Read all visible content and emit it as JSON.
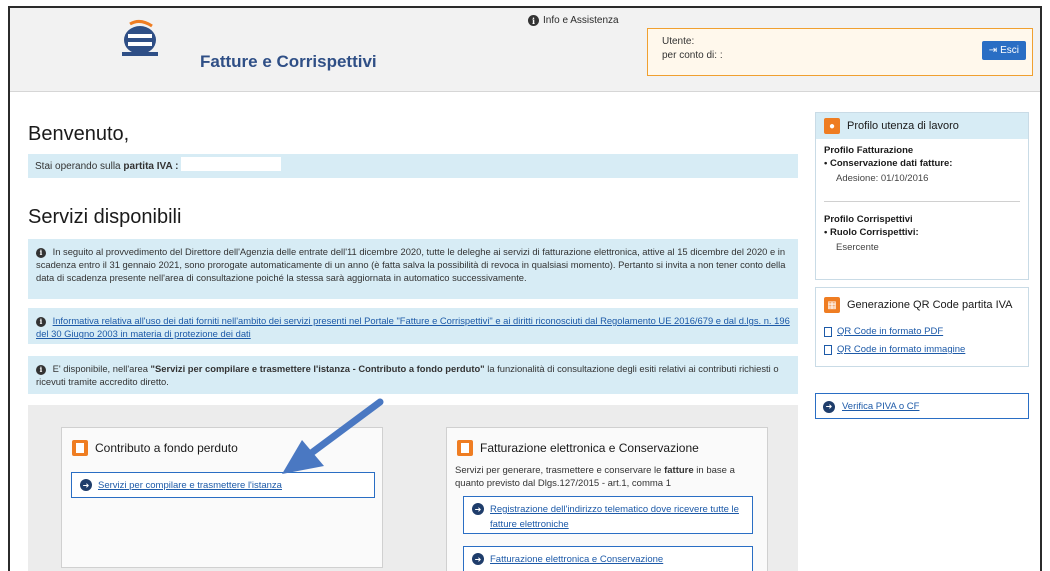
{
  "header": {
    "app_title": "Fatture e Corrispettivi",
    "info_link": "Info e Assistenza",
    "user_label": "Utente:",
    "on_behalf_label": "per conto di: :",
    "logout_label": "Esci"
  },
  "main": {
    "welcome": "Benvenuto,",
    "vat_prefix": "Stai operando sulla ",
    "vat_bold": "partita IVA :",
    "services_title": "Servizi disponibili",
    "notice_1": "In seguito al provvedimento del Direttore dell'Agenzia delle entrate dell'11 dicembre 2020, tutte le deleghe ai servizi di fatturazione elettronica, attive al 15 dicembre del 2020 e in scadenza entro il 31 gennaio 2021, sono prorogate automaticamente di un anno (è fatta salva la possibilità di revoca in qualsiasi momento). Pertanto si invita a non tener conto della data di scadenza presente nell'area di consultazione poiché la stessa sarà aggiornata in automatico successivamente.",
    "notice_2": "Informativa relativa all'uso dei dati forniti nell'ambito dei servizi presenti nel Portale \"Fatture e Corrispettivi\" e ai diritti riconosciuti dal Regolamento UE 2016/679 e dal d.lgs. n. 196 del 30 Giugno 2003 in materia di protezione dei dati",
    "notice_3_pre": "E' disponibile, nell'area ",
    "notice_3_bold": "\"Servizi per compilare e trasmettere l'istanza - Contributo a fondo perduto\"",
    "notice_3_post": " la funzionalità di consultazione degli esiti relativi ai contributi richiesti o ricevuti tramite accredito diretto."
  },
  "cards": {
    "contrib": {
      "title": "Contributo a fondo perduto",
      "link": "Servizi per compilare e trasmettere l'istanza"
    },
    "fatt": {
      "title": "Fatturazione elettronica e Conservazione",
      "desc_pre": "Servizi per generare, trasmettere e conservare le ",
      "desc_bold": "fatture",
      "desc_post": " in base a quanto previsto dal Dlgs.127/2015 - art.1, comma 1",
      "link_1": "Registrazione dell'indirizzo telematico dove ricevere tutte le fatture elettroniche",
      "link_2": "Fatturazione elettronica e Conservazione"
    }
  },
  "sidebar": {
    "profile_title": "Profilo utenza di lavoro",
    "fatt_profile": "Profilo Fatturazione",
    "fatt_item": "Conservazione dati fatture:",
    "fatt_value": "Adesione: 01/10/2016",
    "corr_profile": "Profilo Corrispettivi",
    "corr_item": "Ruolo Corrispettivi:",
    "corr_value": "Esercente",
    "qr_title": "Generazione QR Code partita IVA",
    "qr_pdf": "QR Code in formato PDF",
    "qr_img": "QR Code in formato immagine",
    "verifica": "Verifica PIVA o CF"
  },
  "colors": {
    "accent": "#ef7d22",
    "link": "#1d5aa8",
    "info_bg": "#d7ecf5",
    "arrow": "#4a78c2"
  }
}
